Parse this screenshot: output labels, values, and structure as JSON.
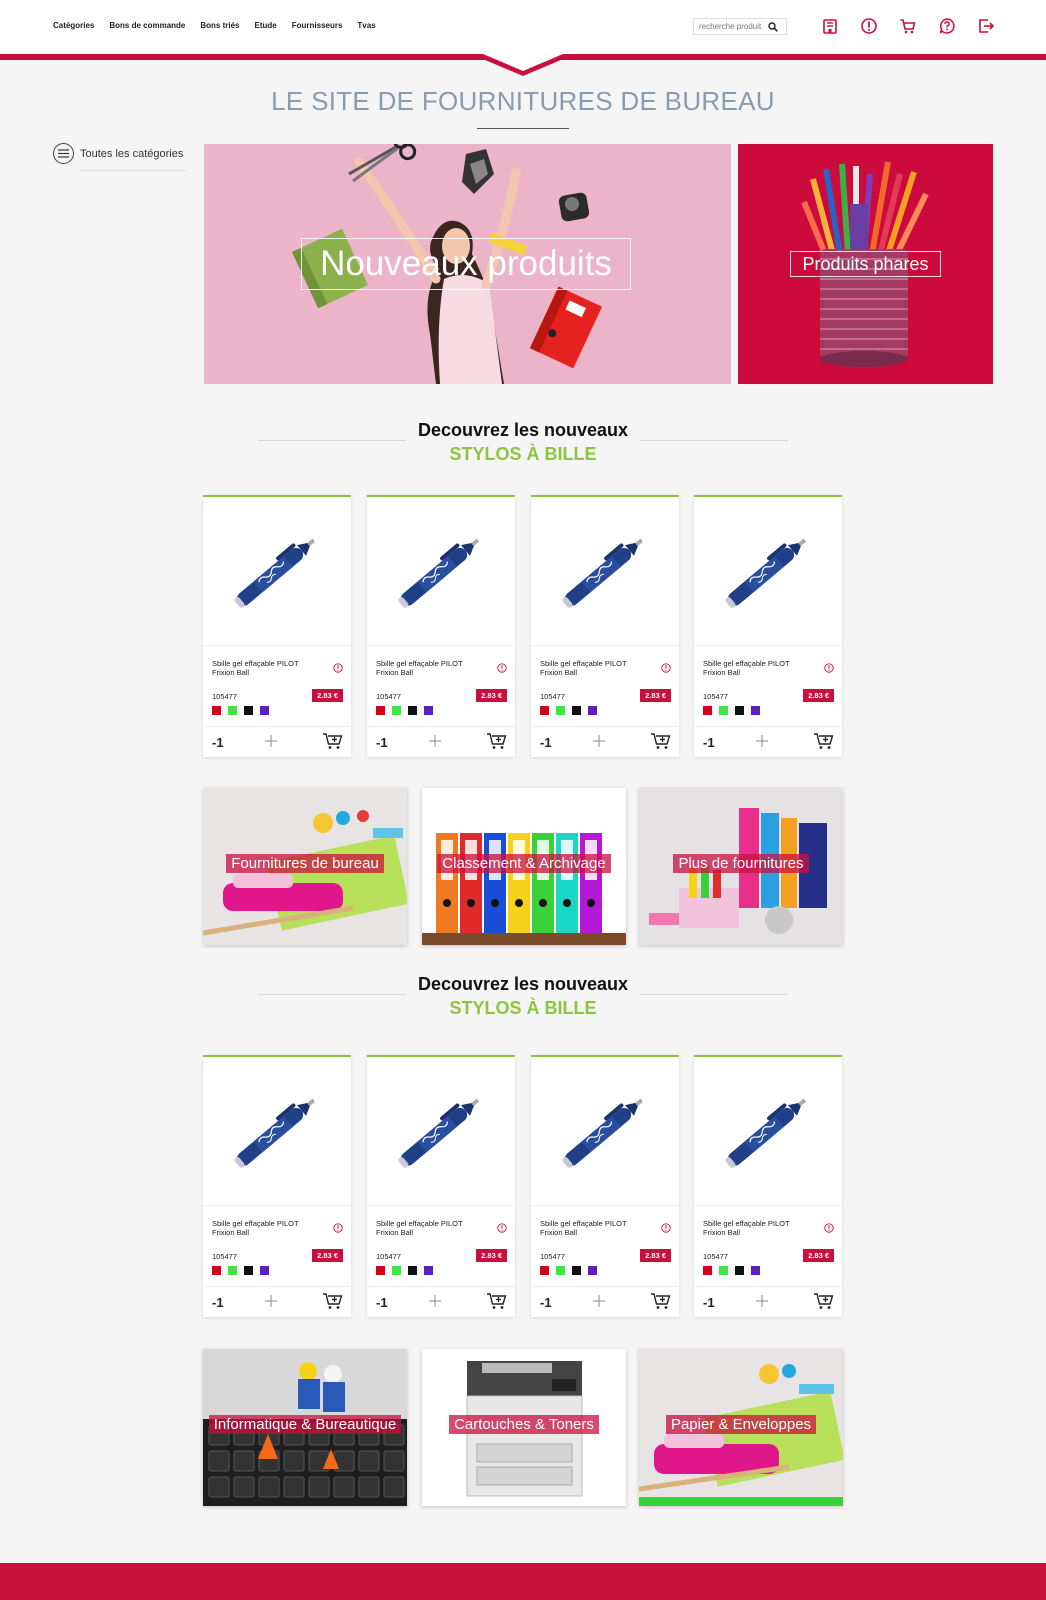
{
  "nav": {
    "items": [
      "Catégories",
      "Bons de commande",
      "Bons triés",
      "Etude",
      "Fournisseurs",
      "Tvas"
    ]
  },
  "search": {
    "placeholder": "recherche produit"
  },
  "header_icons": [
    "building-icon",
    "alert-icon",
    "cart-icon",
    "help-icon",
    "logout-icon"
  ],
  "site_title": "LE SITE DE FOURNITURES DE BUREAU",
  "sidebar": {
    "all_categories": "Toutes les catégories"
  },
  "banners": {
    "left_label": "Nouveaux produits",
    "right_label": "Produits phares"
  },
  "sections": [
    {
      "title_line1": "Decouvrez les nouveaux",
      "title_line2": "STYLOS À BILLE",
      "products": [
        {
          "name": "Sbille gel effaçable PILOT Frixion Ball",
          "ref": "105477",
          "price": "2.83 €",
          "qty": "-1"
        },
        {
          "name": "Sbille gel effaçable PILOT Frixion Ball",
          "ref": "105477",
          "price": "2.83 €",
          "qty": "-1"
        },
        {
          "name": "Sbille gel effaçable PILOT Frixion Ball",
          "ref": "105477",
          "price": "2.83 €",
          "qty": "-1"
        },
        {
          "name": "Sbille gel effaçable PILOT Frixion Ball",
          "ref": "105477",
          "price": "2.83 €",
          "qty": "-1"
        }
      ],
      "categories": [
        "Fournitures de bureau",
        "Classement & Archivage",
        "Plus de fournitures"
      ]
    },
    {
      "title_line1": "Decouvrez les nouveaux",
      "title_line2": "STYLOS À BILLE",
      "products": [
        {
          "name": "Sbille gel effaçable PILOT Frixion Ball",
          "ref": "105477",
          "price": "2.83 €",
          "qty": "-1"
        },
        {
          "name": "Sbille gel effaçable PILOT Frixion Ball",
          "ref": "105477",
          "price": "2.83 €",
          "qty": "-1"
        },
        {
          "name": "Sbille gel effaçable PILOT Frixion Ball",
          "ref": "105477",
          "price": "2.83 €",
          "qty": "-1"
        },
        {
          "name": "Sbille gel effaçable PILOT Frixion Ball",
          "ref": "105477",
          "price": "2.83 €",
          "qty": "-1"
        }
      ],
      "categories": [
        "Informatique & Bureautique",
        "Cartouches & Toners",
        "Papier & Enveloppes"
      ]
    }
  ],
  "swatch_colors": [
    "#d0021b",
    "#3ee83e",
    "#111111",
    "#5b1fc4"
  ],
  "colors": {
    "accent": "#c8103d",
    "green": "#8cc63f",
    "title": "#8a9bb0"
  }
}
